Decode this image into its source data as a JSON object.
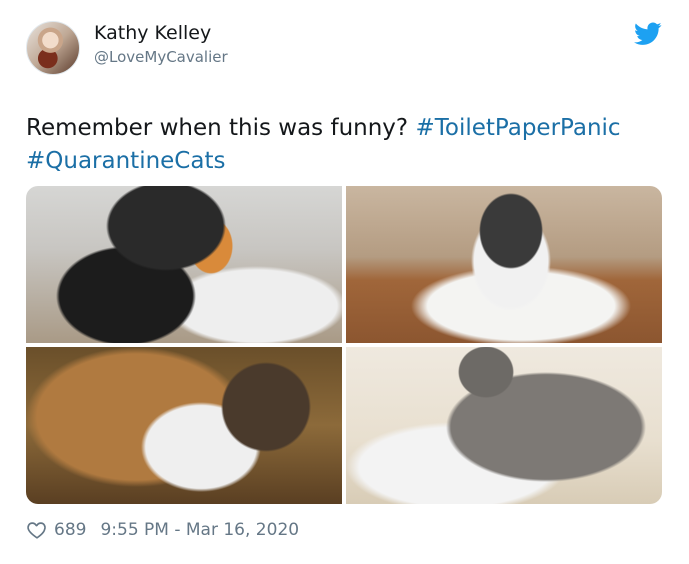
{
  "author": {
    "name": "Kathy Kelley",
    "handle": "@LoveMyCavalier"
  },
  "icons": {
    "logo": "twitter-bird-icon",
    "like": "heart-icon"
  },
  "colors": {
    "brand": "#1da1f2",
    "hashtag": "#1b6fa6",
    "secondary_text": "#657786",
    "text": "#14171a"
  },
  "tweet": {
    "text_main": "Remember when this was funny? ",
    "hashtags": [
      "#ToiletPaperPanic",
      "#QuarantineCats"
    ]
  },
  "footer": {
    "likes": "689",
    "timestamp": "9:55 PM - Mar 16, 2020"
  }
}
